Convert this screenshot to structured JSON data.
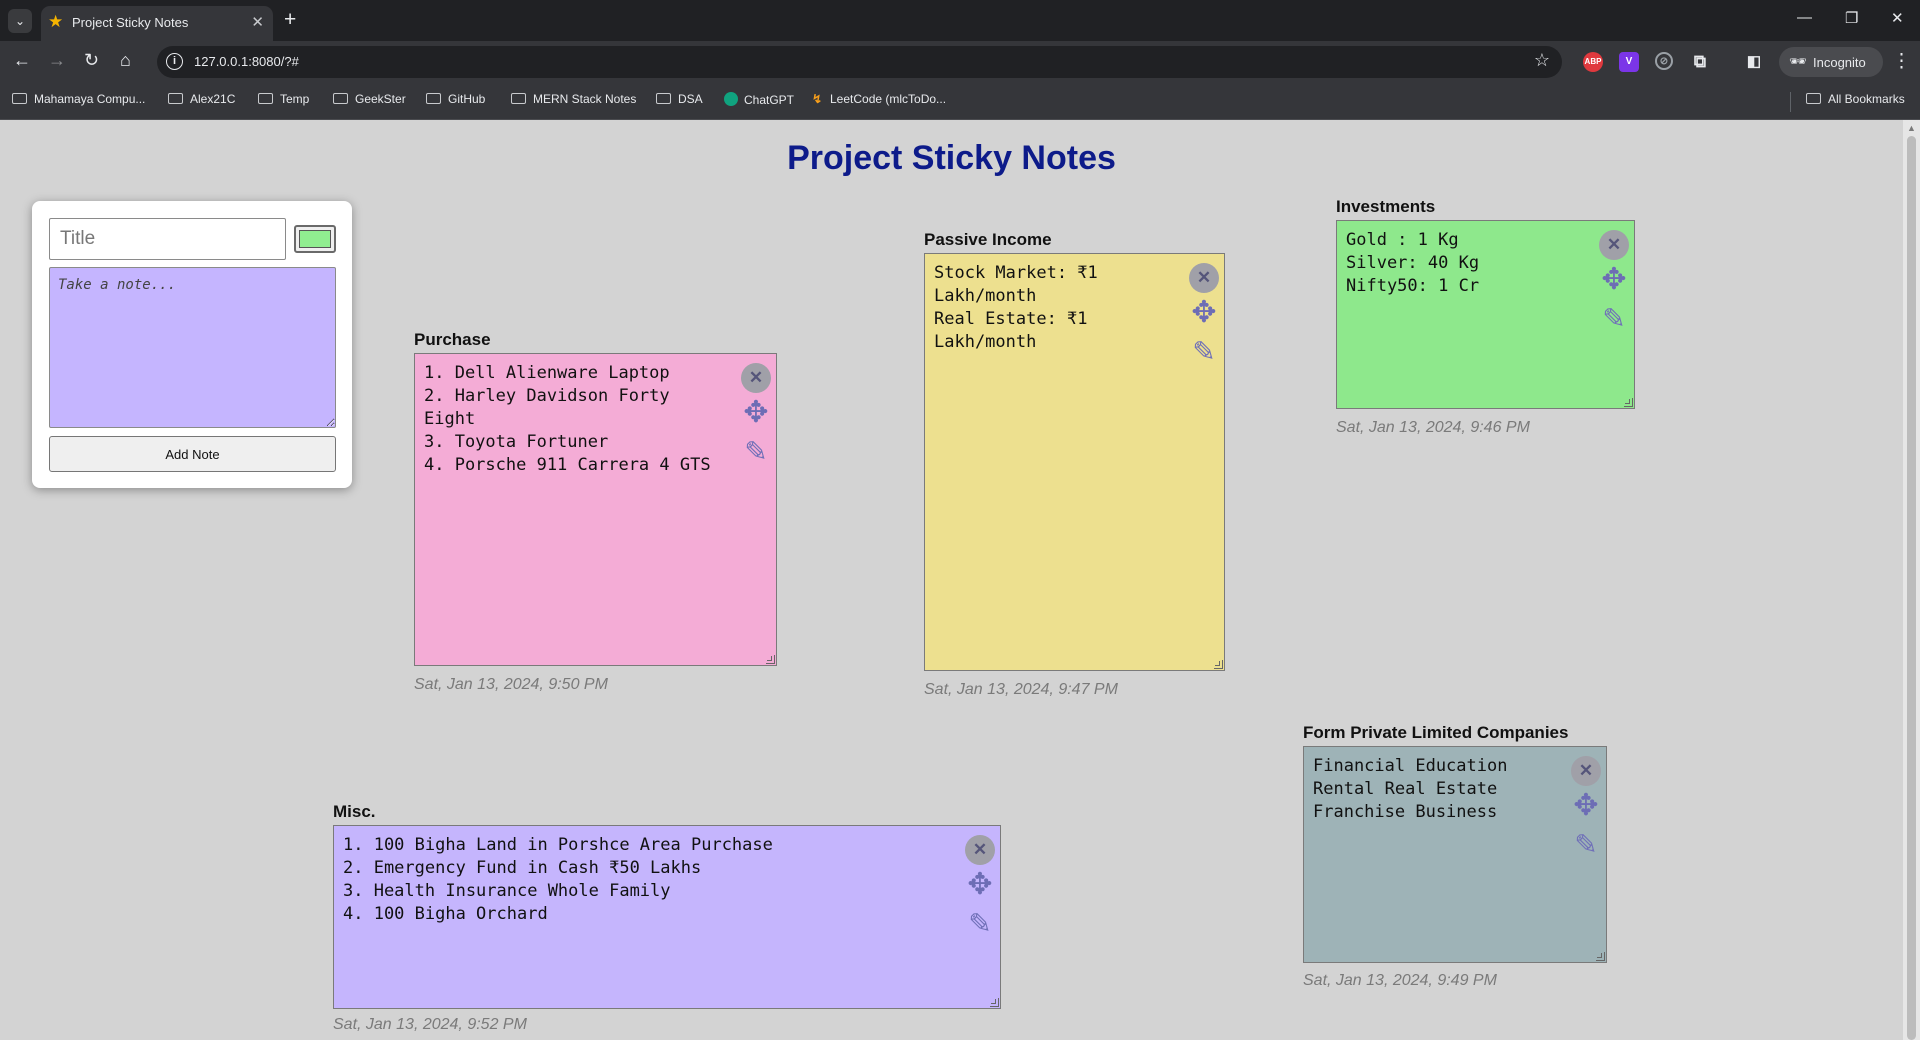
{
  "browser": {
    "tab": {
      "title": "Project Sticky Notes",
      "close_glyph": "✕"
    },
    "new_tab_glyph": "+",
    "window_controls": {
      "minimize": "—",
      "restore": "❐",
      "close": "✕"
    },
    "nav": {
      "back": "←",
      "forward": "→",
      "reload": "↻",
      "home": "⌂"
    },
    "url": "127.0.0.1:8080/?#",
    "incognito_label": "Incognito",
    "extensions": {
      "abp": "ABP",
      "v": "V"
    },
    "bookmarks": [
      {
        "label": "Mahamaya Compu...",
        "icon": "folder-icon"
      },
      {
        "label": "Alex21C",
        "icon": "folder-icon"
      },
      {
        "label": "Temp",
        "icon": "folder-icon"
      },
      {
        "label": "GeekSter",
        "icon": "folder-icon"
      },
      {
        "label": "GitHub",
        "icon": "folder-icon"
      },
      {
        "label": "MERN Stack Notes",
        "icon": "folder-icon"
      },
      {
        "label": "DSA",
        "icon": "folder-icon"
      },
      {
        "label": "ChatGPT",
        "icon": "chatgpt-icon"
      },
      {
        "label": "LeetCode (mlcToDo...",
        "icon": "leetcode-icon"
      }
    ],
    "all_bookmarks": "All Bookmarks"
  },
  "page": {
    "title": "Project Sticky Notes",
    "form": {
      "title_placeholder": "Title",
      "title_value": "",
      "note_placeholder": "Take a note...",
      "note_value": "",
      "selected_color": "#90ee90",
      "note_area_color": "#c5b5ff",
      "add_button": "Add Note"
    },
    "notes": [
      {
        "title": "Purchase",
        "content": "1. Dell Alienware Laptop\n2. Harley Davidson Forty\nEight\n3. Toyota Fortuner\n4. Porsche 911 Carrera 4 GTS",
        "color": "#f4acd6",
        "date": "Sat, Jan 13, 2024, 9:50 PM"
      },
      {
        "title": "Passive Income",
        "content": "Stock Market: ₹1\nLakh/month\nReal Estate: ₹1\nLakh/month",
        "color": "#ede08f",
        "date": "Sat, Jan 13, 2024, 9:47 PM"
      },
      {
        "title": "Investments",
        "content": "Gold : 1 Kg\nSilver: 40 Kg\nNifty50: 1 Cr",
        "color": "#8ee88c",
        "date": "Sat, Jan 13, 2024, 9:46 PM"
      },
      {
        "title": "Misc.",
        "content": "1. 100 Bigha Land in Porshce Area Purchase\n2. Emergency Fund in Cash ₹50 Lakhs\n3. Health Insurance Whole Family\n4. 100 Bigha Orchard",
        "color": "#c5b5fd",
        "date": "Sat, Jan 13, 2024, 9:52 PM"
      },
      {
        "title": "Form Private Limited Companies",
        "content": "Financial Education\nRental Real Estate\nFranchise Business",
        "color": "#9eb3b7",
        "date": "Sat, Jan 13, 2024, 9:49 PM"
      }
    ],
    "note_controls": {
      "close": "✕",
      "move": "✥",
      "edit": "✎"
    }
  }
}
